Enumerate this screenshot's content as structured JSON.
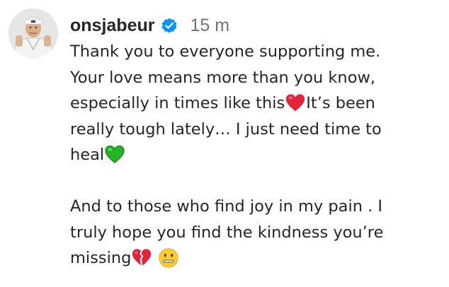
{
  "post": {
    "username": "onsjabeur",
    "timestamp": "15 m",
    "caption_lines": [
      "Thank you to everyone supporting me.",
      "Your love means more than you know,",
      "especially in times like this",
      "It’s been",
      "really tough lately… I just need time to",
      "heal",
      " And to those who find joy in my pain . I",
      "truly hope you find the kindness you’re",
      "missing"
    ]
  },
  "icons": {
    "verified": "verified-badge-icon",
    "red_heart": "red-heart-icon",
    "green_heart": "green-heart-icon",
    "broken_heart": "broken-heart-icon",
    "zipper_face": "zipper-mouth-face-icon"
  },
  "colors": {
    "text": "#262626",
    "muted": "#737373",
    "verified": "#0095f6",
    "red_heart": "#e0243a",
    "green_heart": "#22b422"
  }
}
